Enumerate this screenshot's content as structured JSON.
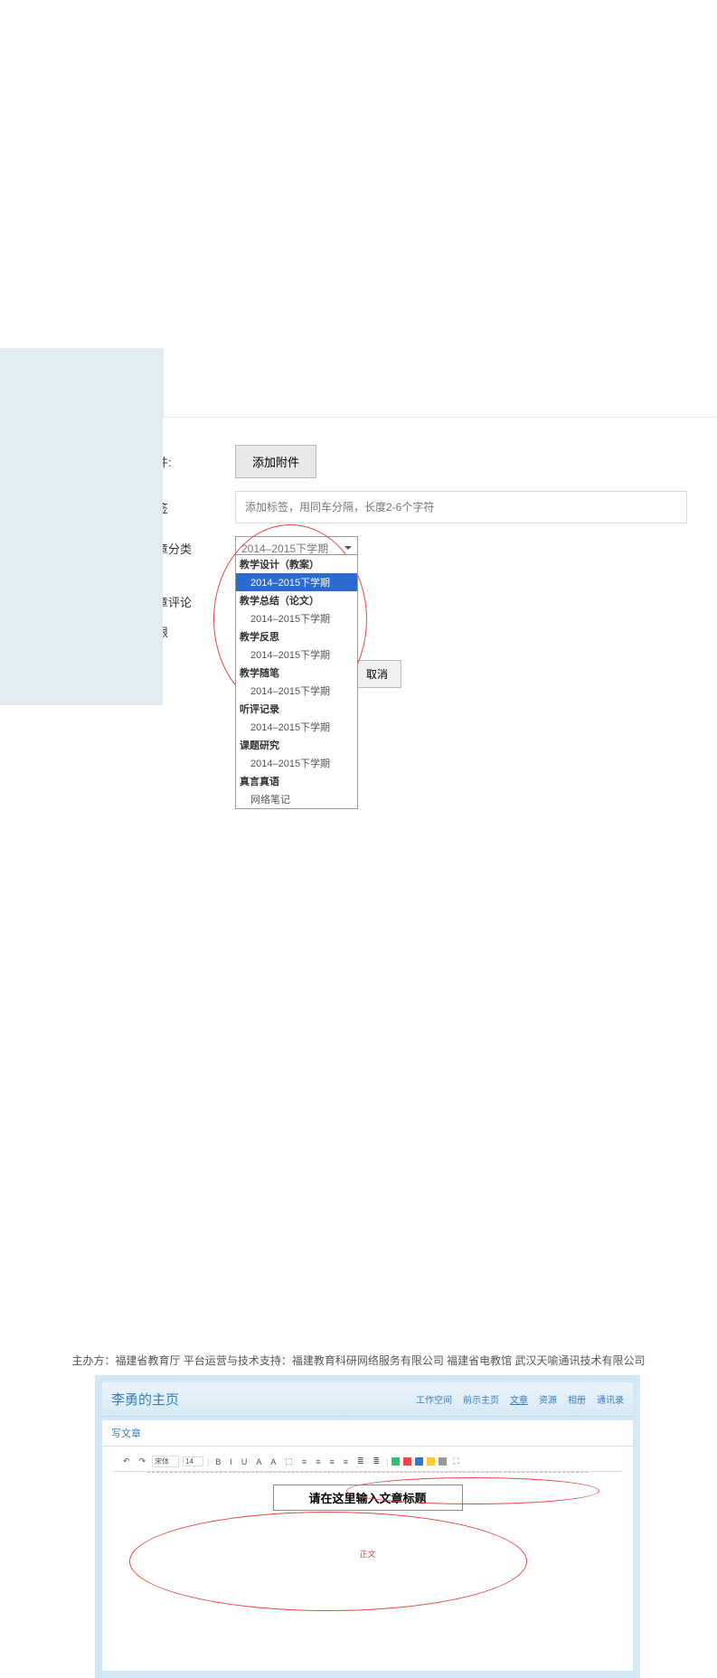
{
  "form": {
    "attachment_label": "附件:",
    "attachment_btn": "添加附件",
    "tags_label": "标签",
    "tags_placeholder": "添加标签，用同车分隔，长度2-6个字符",
    "category_label": "文章分类",
    "category_value": "2014–2015下学期",
    "comment_label": "文章评论",
    "permission_label": "权限",
    "cancel_btn": "取消"
  },
  "dropdown": [
    {
      "type": "cat",
      "text": "教学设计（教案）"
    },
    {
      "type": "item",
      "text": "2014–2015下学期",
      "selected": true
    },
    {
      "type": "cat",
      "text": "教学总结（论文）"
    },
    {
      "type": "item",
      "text": "2014–2015下学期"
    },
    {
      "type": "cat",
      "text": "教学反思"
    },
    {
      "type": "item",
      "text": "2014–2015下学期"
    },
    {
      "type": "cat",
      "text": "教学随笔"
    },
    {
      "type": "item",
      "text": "2014–2015下学期"
    },
    {
      "type": "cat",
      "text": "听评记录"
    },
    {
      "type": "item",
      "text": "2014–2015下学期"
    },
    {
      "type": "cat",
      "text": "课题研究"
    },
    {
      "type": "item",
      "text": "2014–2015下学期"
    },
    {
      "type": "cat",
      "text": "真言真语"
    },
    {
      "type": "item",
      "text": "网络笔记"
    }
  ],
  "footer": "主办方：福建省教育厅 平台运营与技术支持：福建教育科研网络服务有限公司 福建省电教馆 武汉天喻通讯技术有限公司",
  "panel": {
    "title": "李勇的主页",
    "nav": [
      "工作空间",
      "前示主页",
      "文章",
      "资源",
      "相册",
      "通讯录"
    ],
    "nav_active_index": 2,
    "write_tab": "写文章",
    "title_placeholder": "请在这里输入文章标题",
    "body_label": "正文"
  },
  "toolbar": {
    "font_family": "宋体",
    "font_size": "14",
    "items": [
      "B",
      "I",
      "U",
      "A",
      "A",
      "⬚",
      "≡",
      "≡",
      "≡",
      "≡",
      "≣",
      "≣"
    ],
    "colors": [
      "#3b7",
      "#e44",
      "#37c",
      "#fc3",
      "#999"
    ]
  }
}
